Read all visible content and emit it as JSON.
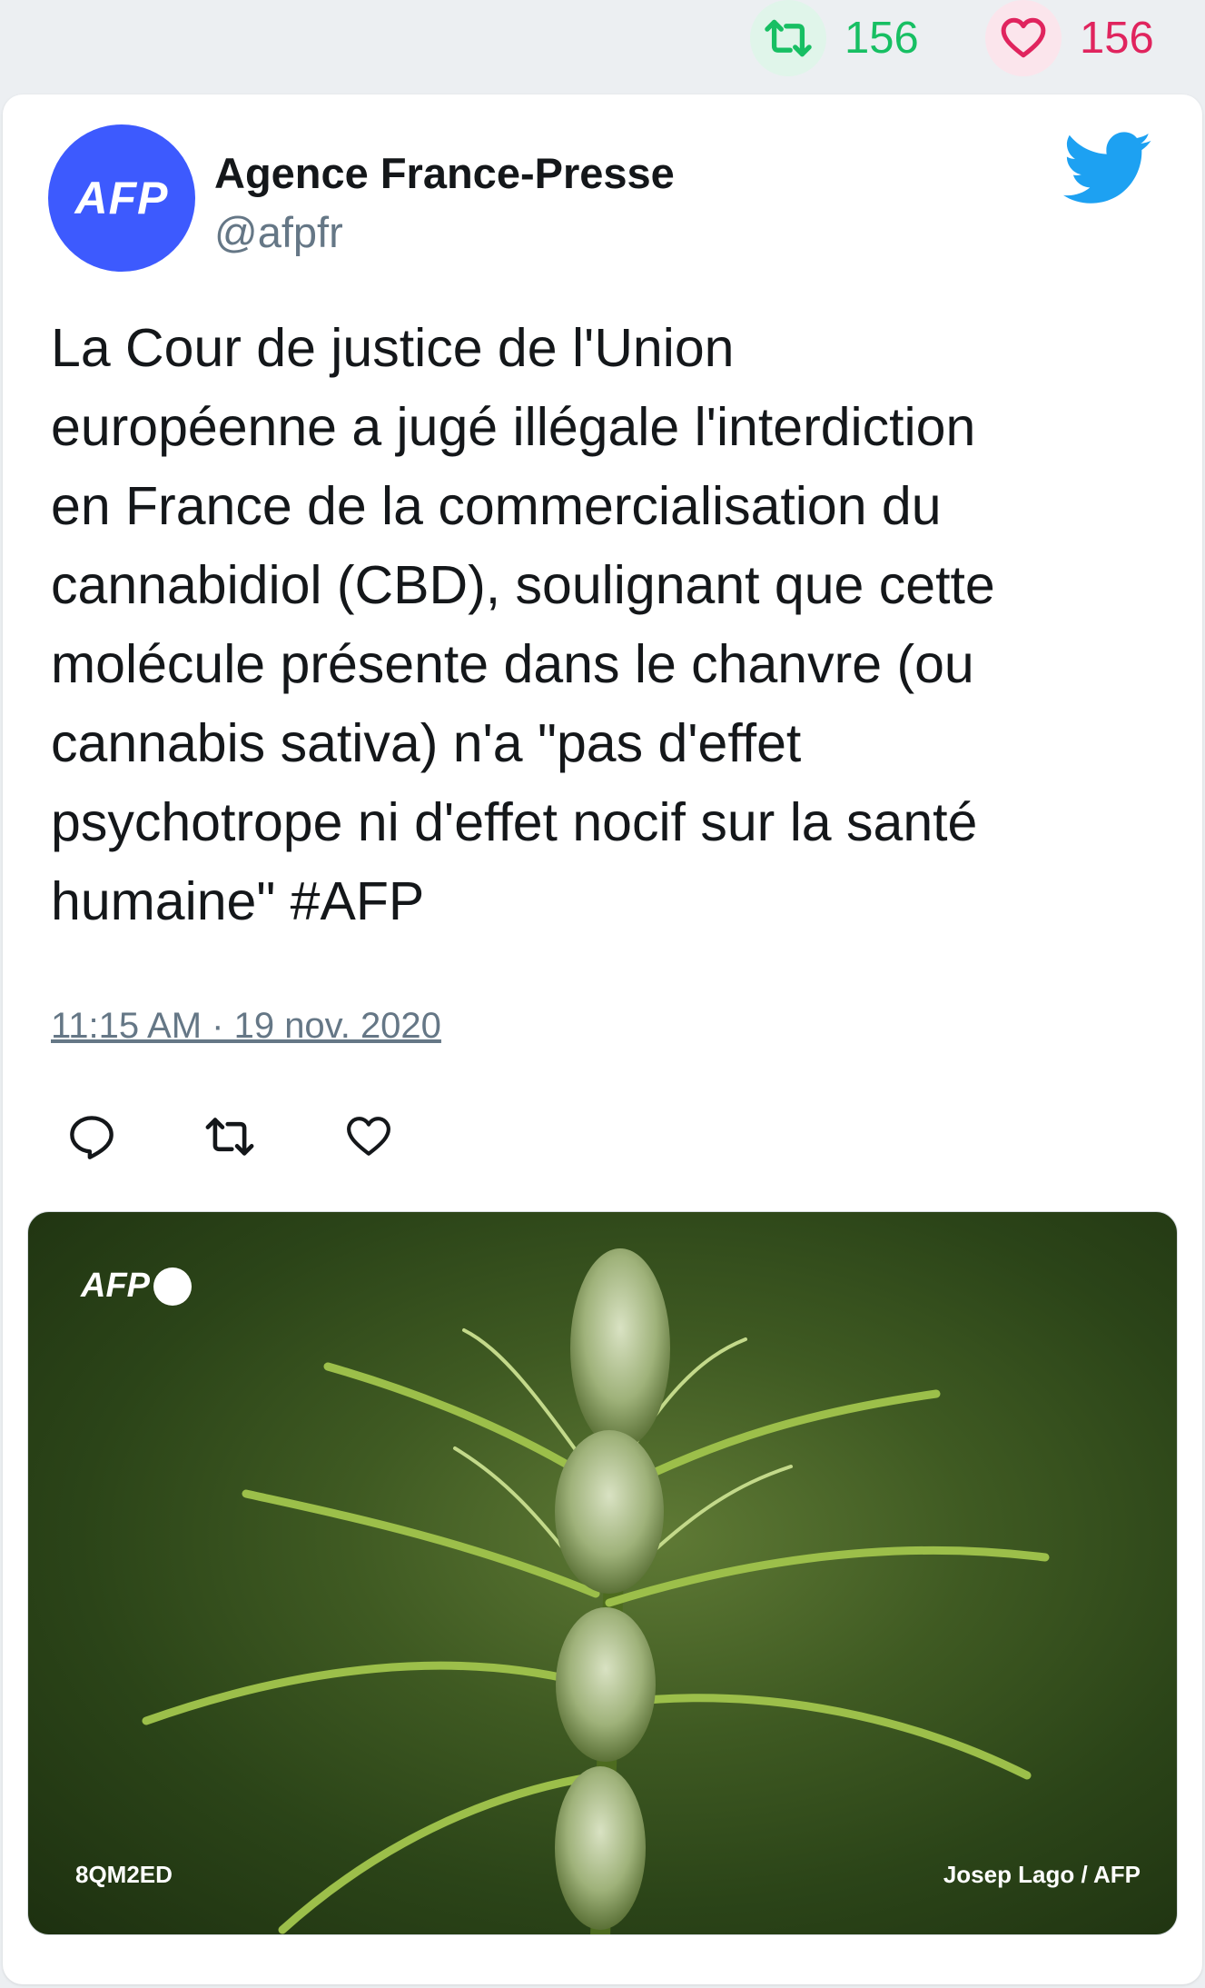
{
  "stats": {
    "retweet_count": "156",
    "like_count": "156"
  },
  "author": {
    "avatar_text": "AFP",
    "name": "Agence France-Presse",
    "handle": "@afpfr"
  },
  "tweet": {
    "text": "La Cour de justice de l'Union\neuropéenne a jugé illégale l'interdiction\nen France de la commercialisation du\ncannabidiol (CBD), soulignant que cette\nmolécule présente dans le chanvre (ou\ncannabis sativa) n'a \"pas d'effet\npsychotrope ni d'effet nocif sur la santé\nhumaine\" #AFP",
    "timestamp": "11:15 AM · 19 nov. 2020"
  },
  "actions": {
    "reply_icon": "reply-icon",
    "retweet_icon": "retweet-icon",
    "like_icon": "heart-icon"
  },
  "media": {
    "watermark": "AFP",
    "photo_id": "8QM2ED",
    "credit": "Josep Lago / AFP"
  },
  "colors": {
    "retweet": "#17bf63",
    "like": "#e0245e",
    "twitter_blue": "#1da1f2",
    "avatar_bg": "#3d5afe"
  }
}
